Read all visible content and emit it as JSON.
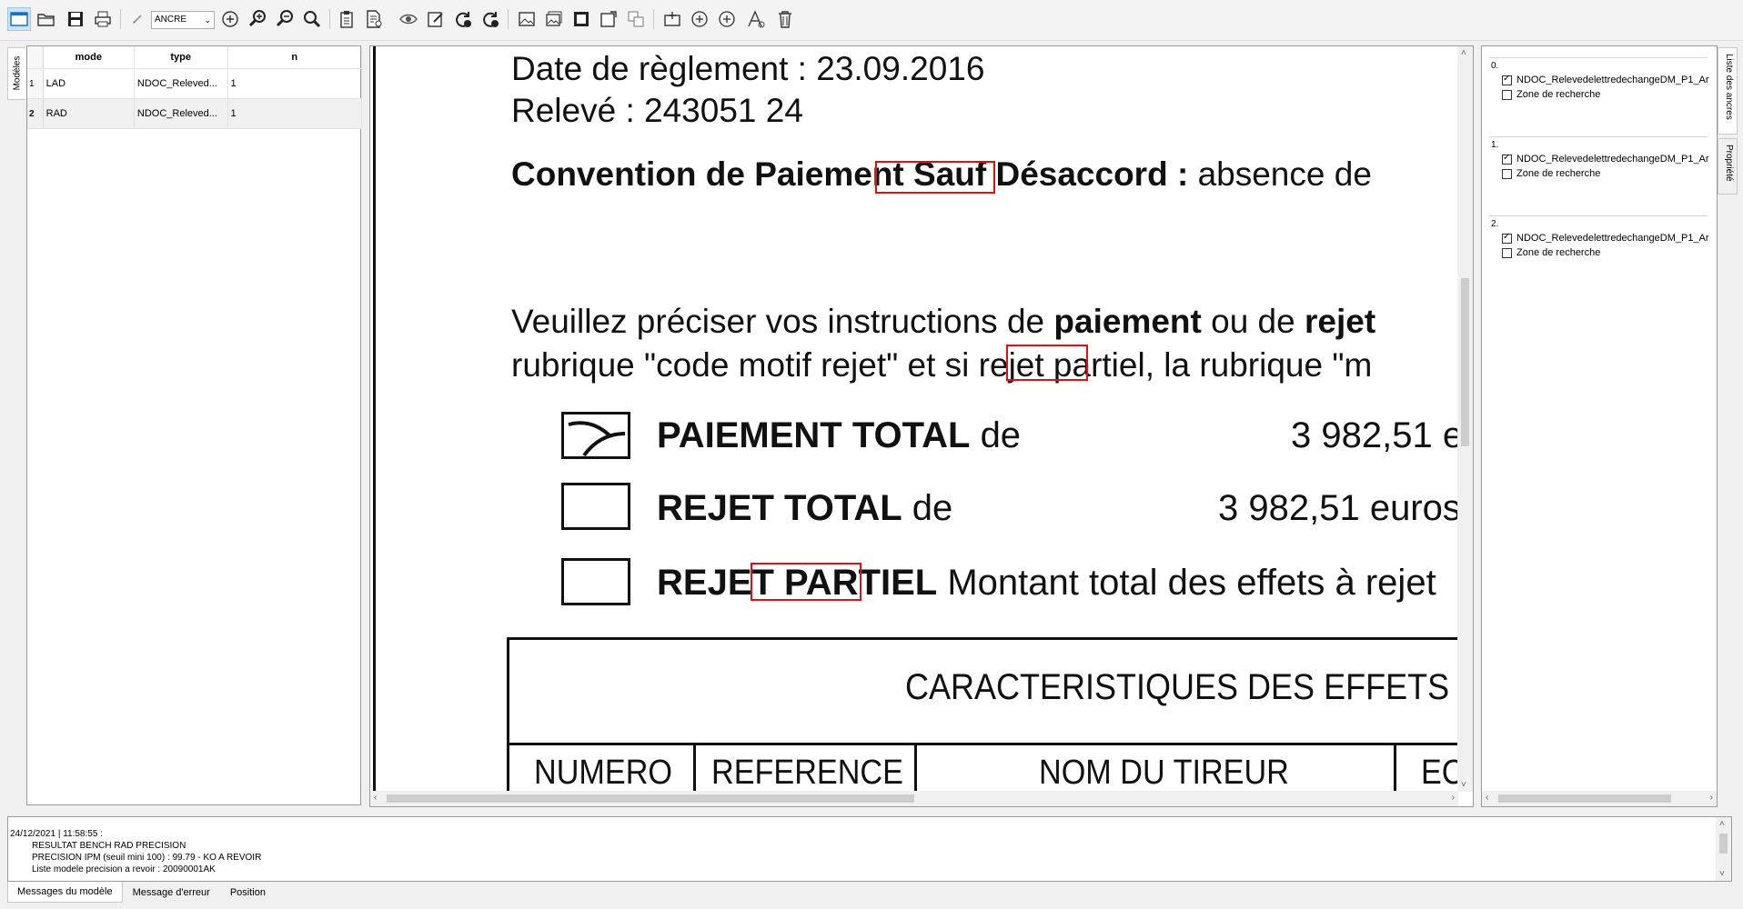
{
  "toolbar": {
    "mode_select": "ANCRE",
    "icons": [
      "new-window-icon",
      "open-folder-icon",
      "save-icon",
      "print-icon",
      "pencil-icon",
      "zoom-in-circle-icon",
      "zoom-in-icon",
      "zoom-out-icon",
      "search-icon",
      "clipboard-icon",
      "document-settings-icon",
      "eye-icon",
      "edit-note-icon",
      "refresh-check-icon",
      "refresh-icon",
      "image-icon",
      "images-icon",
      "frame-icon",
      "image-export-icon",
      "move-icon",
      "add-box-icon",
      "add-circle-icon",
      "add-circle-2-icon",
      "text-style-icon",
      "trash-icon"
    ]
  },
  "left_tab": {
    "label": "Modèles"
  },
  "models": {
    "headers": {
      "mode": "mode",
      "type": "type",
      "n": "n"
    },
    "rows": [
      {
        "num": "1",
        "mode": "LAD",
        "type": "NDOC_Releved...",
        "n": "1"
      },
      {
        "num": "2",
        "mode": "RAD",
        "type": "NDOC_Releved...",
        "n": "1"
      }
    ]
  },
  "document": {
    "line1": "Date de règlement : 23.09.2016",
    "line2": "Relevé : 243051 24",
    "convention_bold": "Convention de Paiement Sauf Désaccord :",
    "convention_rest": "absence de",
    "instr_a": "Veuillez préciser vos instructions de",
    "instr_b": "paiement",
    "instr_c": "ou de",
    "instr_d": "rejet",
    "instr2": "rubrique \"code motif rejet\" et si rejet partiel, la rubrique \"m",
    "opt1_bold": "PAIEMENT TOTAL",
    "opt1_de": "de",
    "opt1_amount": "3 982,51 e",
    "opt2_bold": "REJET TOTAL",
    "opt2_de": "de",
    "opt2_amount": "3 982,51 euros",
    "opt3_bold": "REJET PARTIEL",
    "opt3_rest": "Montant total des effets à rejet",
    "table_title": "CARACTERISTIQUES DES EFFETS EN",
    "col1": "NUMERO",
    "col2": "REFERENCE",
    "col3": "NOM DU TIREUR",
    "col4": "EC"
  },
  "anchors": {
    "groups": [
      {
        "title": "0.",
        "item": "NDOC_RelevedelettredechangeDM_P1_Ar",
        "zone": "Zone de recherche",
        "item_checked": true,
        "zone_checked": false
      },
      {
        "title": "1.",
        "item": "NDOC_RelevedelettredechangeDM_P1_Ar",
        "zone": "Zone de recherche",
        "item_checked": true,
        "zone_checked": false
      },
      {
        "title": "2.",
        "item": "NDOC_RelevedelettredechangeDM_P1_Ar",
        "zone": "Zone de recherche",
        "item_checked": true,
        "zone_checked": false
      }
    ]
  },
  "right_tabs": {
    "tab1": "Liste des ancres",
    "tab2": "Propriété"
  },
  "log": {
    "line1": "24/12/2021 | 11:58:55 :",
    "line2": "RESULTAT BENCH RAD PRECISION",
    "line3": "PRECISION IPM (seuil mini 100) : 99.79 - KO A REVOIR",
    "line4": "Liste modele precision a revoir : 20090001AK"
  },
  "bottom_tabs": {
    "tab1": "Messages du modèle",
    "tab2": "Message d'erreur",
    "tab3": "Position"
  },
  "colors": {
    "highlight": "#e01010",
    "selection": "#cce4f7"
  }
}
